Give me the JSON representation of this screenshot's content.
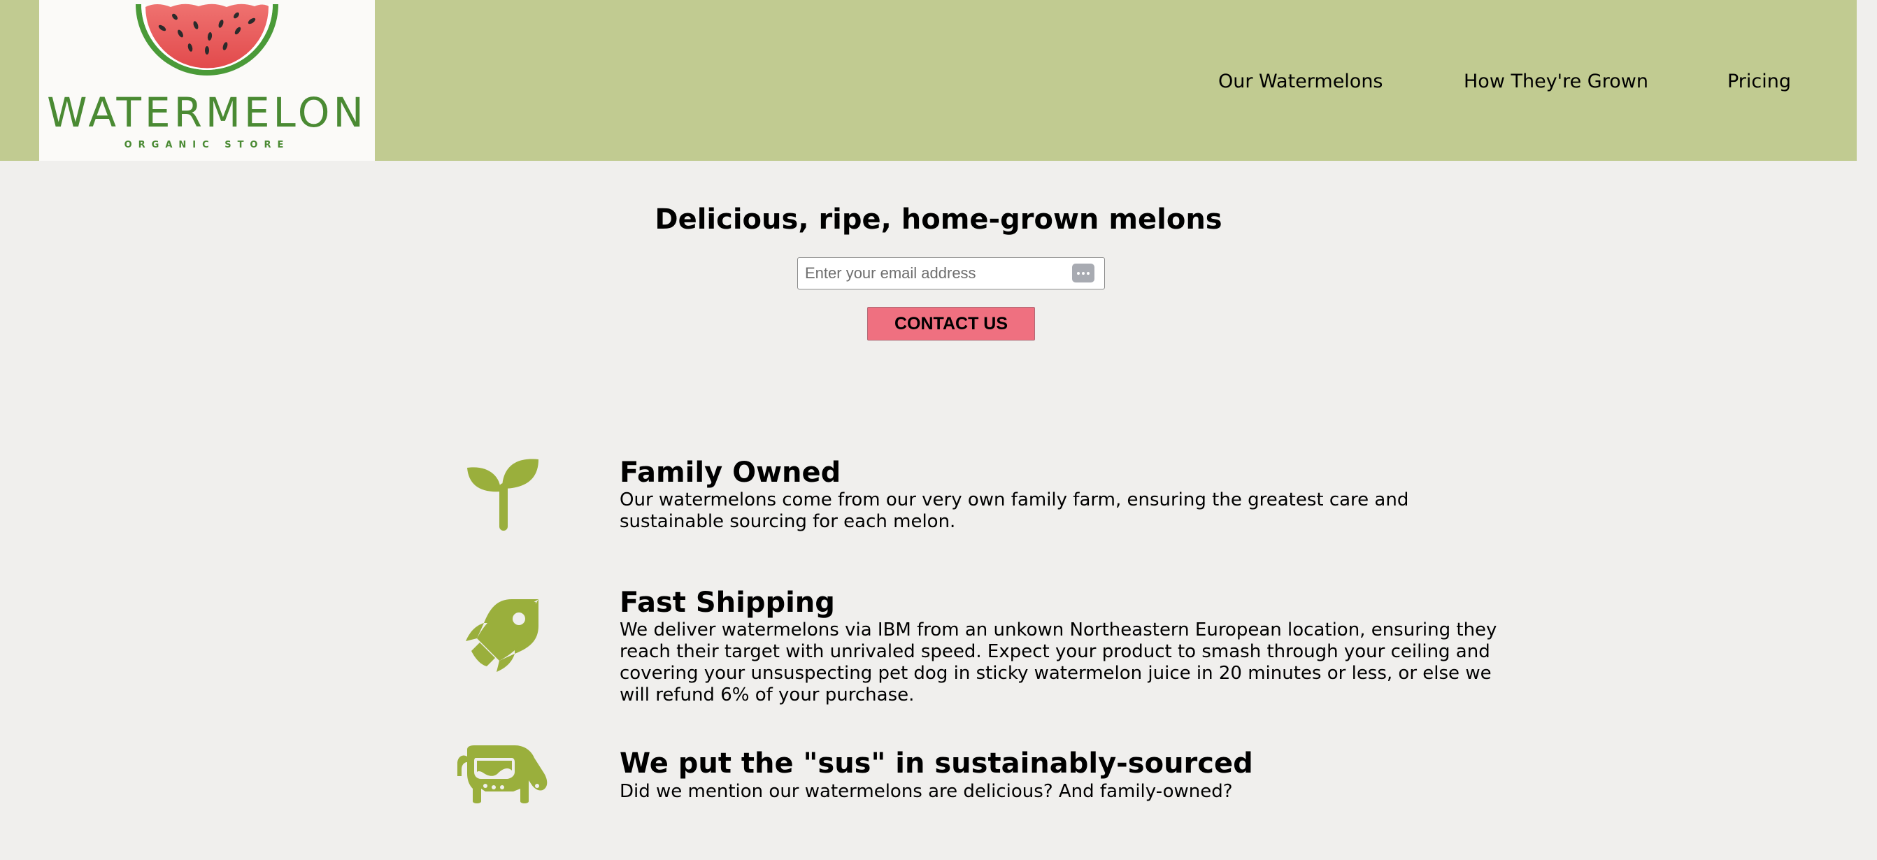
{
  "header": {
    "logo": {
      "wordmark": "WATERMELON",
      "tagline": "ORGANIC STORE"
    },
    "nav": [
      {
        "label": "Our Watermelons"
      },
      {
        "label": "How They're Grown"
      },
      {
        "label": "Pricing"
      }
    ]
  },
  "hero": {
    "title": "Delicious, ripe, home-grown melons",
    "email_placeholder": "Enter your email address",
    "contact_label": "CONTACT US"
  },
  "features": [
    {
      "icon": "sprout-icon",
      "title": "Family Owned",
      "body": "Our watermelons come from our very own family farm, ensuring the greatest care and sustainable sourcing for each melon."
    },
    {
      "icon": "rocket-icon",
      "title": "Fast Shipping",
      "body": "We deliver watermelons via IBM from an unkown Northeastern European location, ensuring they reach their target with unrivaled speed. Expect your product to smash through your ceiling and covering your unsuspecting pet dog in sticky watermelon juice in 20 minutes or less, or else we will refund 6% of your purchase."
    },
    {
      "icon": "cow-icon",
      "title": "We put the \"sus\" in sustainably-sourced",
      "body": "Did we mention our watermelons are delicious? And family-owned?"
    }
  ],
  "colors": {
    "header_bg": "#c1cb91",
    "page_bg": "#f0efed",
    "brand_green": "#4a8a33",
    "icon_green": "#9aaf3c",
    "button_pink": "#ef7080"
  }
}
